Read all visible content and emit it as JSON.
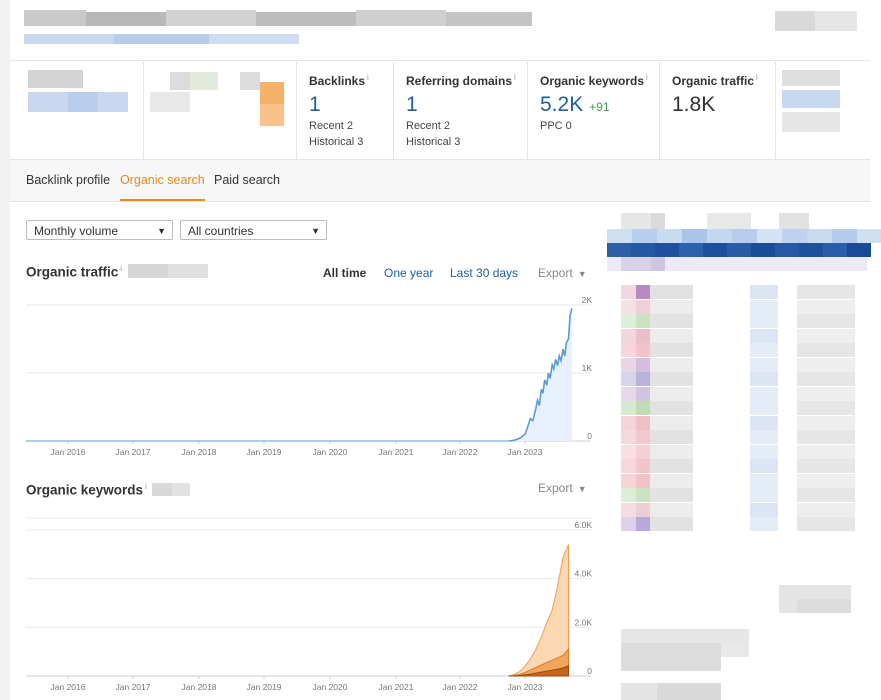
{
  "metrics": [
    {
      "label": "Backlinks",
      "info": "i",
      "value": "1",
      "sub1": "Recent 2",
      "sub2": "Historical 3"
    },
    {
      "label": "Referring domains",
      "info": "i",
      "value": "1",
      "sub1": "Recent 2",
      "sub2": "Historical 3"
    },
    {
      "label": "Organic keywords",
      "info": "i",
      "value": "5.2K",
      "delta": "+91",
      "sub1": "PPC 0"
    },
    {
      "label": "Organic traffic",
      "info": "i",
      "value": "1.8K"
    }
  ],
  "tabs": [
    "Backlink profile",
    "Organic search",
    "Paid search"
  ],
  "filters": {
    "volume": "Monthly volume",
    "countries": "All countries"
  },
  "traffic": {
    "title": "Organic traffic",
    "info": "i",
    "ranges": [
      "All time",
      "One year",
      "Last 30 days"
    ],
    "export": "Export"
  },
  "keywords": {
    "title": "Organic keywords",
    "info": "i",
    "export": "Export"
  },
  "colors": {
    "accent": "#e68a1e",
    "link": "#1e5fa6",
    "traffic_line": "#5b9bd5",
    "traffic_fill": "#e8f1fb",
    "kw_light": "#fbd8b2",
    "kw_mid": "#f2a55c",
    "kw_dark": "#c8651c"
  },
  "chart_data": [
    {
      "type": "area",
      "title": "Organic traffic",
      "x_tick_labels": [
        "Jan 2016",
        "Jan 2017",
        "Jan 2018",
        "Jan 2019",
        "Jan 2020",
        "Jan 2021",
        "Jan 2022",
        "Jan 2023"
      ],
      "y_tick_labels": [
        "2K",
        "1K",
        "0"
      ],
      "ylim": [
        0,
        2000
      ],
      "series": [
        {
          "x": [
            "2022-10",
            "2022-11",
            "2022-12",
            "2023-01",
            "2023-01-15",
            "2023-02",
            "2023-02-15",
            "2023-03",
            "2023-03-10",
            "2023-03-20",
            "2023-04",
            "2023-04-10",
            "2023-04-20",
            "2023-05",
            "2023-05-10",
            "2023-05-20",
            "2023-06",
            "2023-06-10",
            "2023-06-20",
            "2023-07",
            "2023-07-10",
            "2023-07-20",
            "2023-08",
            "2023-08-10",
            "2023-08-20",
            "2023-09",
            "2023-09-10",
            "2023-09-20"
          ],
          "y": [
            0,
            10,
            40,
            100,
            200,
            330,
            300,
            480,
            600,
            520,
            760,
            700,
            900,
            820,
            1000,
            920,
            1120,
            1060,
            1200,
            1110,
            1250,
            1180,
            1350,
            1250,
            1450,
            1500,
            1850,
            1950
          ]
        }
      ]
    },
    {
      "type": "area",
      "title": "Organic keywords",
      "x_tick_labels": [
        "Jan 2016",
        "Jan 2017",
        "Jan 2018",
        "Jan 2019",
        "Jan 2020",
        "Jan 2021",
        "Jan 2022",
        "Jan 2023"
      ],
      "y_tick_labels": [
        "6.0K",
        "4.0K",
        "2.0K",
        "0"
      ],
      "ylim": [
        0,
        6000
      ],
      "x": [
        "2022-10",
        "2022-11",
        "2022-12",
        "2023-01",
        "2023-02",
        "2023-03",
        "2023-04",
        "2023-05",
        "2023-06",
        "2023-07",
        "2023-08",
        "2023-09"
      ],
      "series": [
        {
          "values": [
            0,
            60,
            180,
            400,
            700,
            1100,
            1600,
            2200,
            2700,
            3700,
            4900,
            5400
          ]
        },
        {
          "values": [
            0,
            20,
            60,
            150,
            250,
            350,
            450,
            550,
            650,
            750,
            850,
            1100
          ]
        },
        {
          "values": [
            0,
            5,
            20,
            50,
            80,
            120,
            160,
            200,
            240,
            280,
            330,
            420
          ]
        }
      ]
    }
  ]
}
